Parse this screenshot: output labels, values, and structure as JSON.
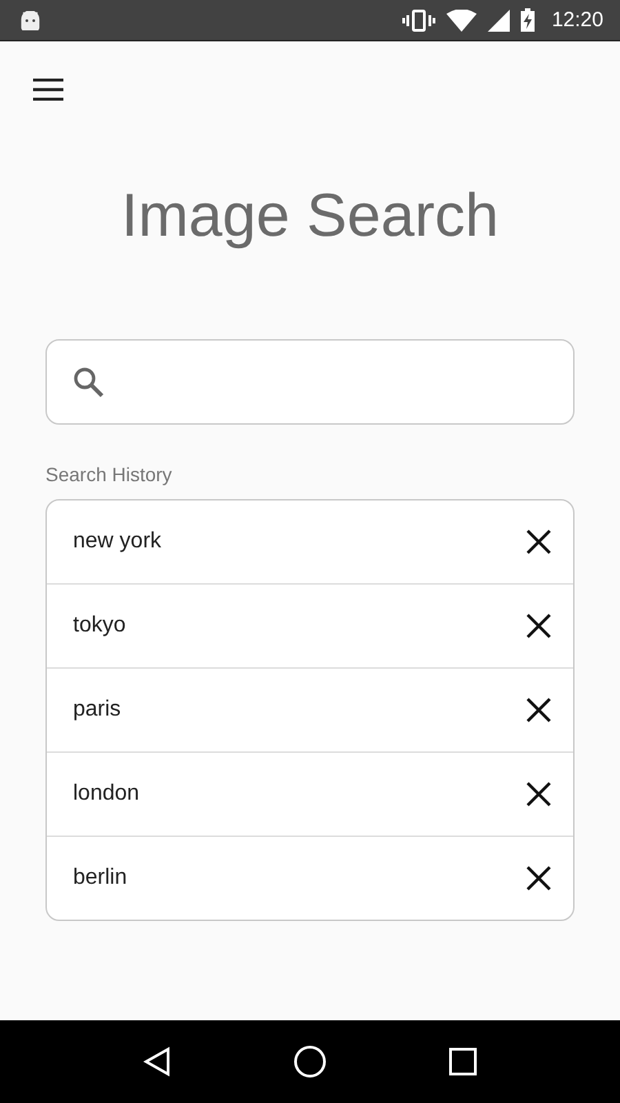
{
  "status_bar": {
    "time": "12:20"
  },
  "title": "Image Search",
  "history": {
    "label": "Search History",
    "items": [
      {
        "text": "new york"
      },
      {
        "text": "tokyo"
      },
      {
        "text": "paris"
      },
      {
        "text": "london"
      },
      {
        "text": "berlin"
      }
    ]
  }
}
